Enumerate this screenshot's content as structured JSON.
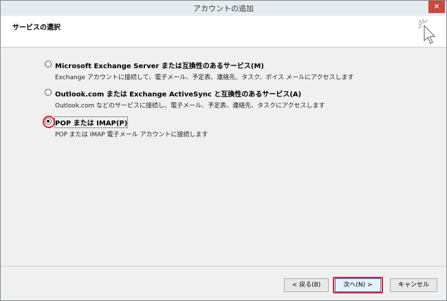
{
  "window": {
    "title": "アカウントの追加",
    "close_symbol": "✕"
  },
  "header": {
    "title": "サービスの選択",
    "icon": "cursor-sparkle-icon"
  },
  "options": [
    {
      "label": "Microsoft Exchange Server または互換性のあるサービス(M)",
      "description": "Exchange アカウントに接続して、電子メール、予定表、連絡先、タスク、ボイス メールにアクセスします",
      "selected": false
    },
    {
      "label": "Outlook.com または Exchange ActiveSync と互換性のあるサービス(A)",
      "description": "Outlook.com などのサービスに接続し、電子メール、予定表、連絡先、タスクにアクセスします",
      "selected": false
    },
    {
      "label": "POP または IMAP(P)",
      "description": "POP または IMAP 電子メール アカウントに接続します",
      "selected": true
    }
  ],
  "buttons": {
    "back": "< 戻る(B)",
    "next": "次へ(N) >",
    "cancel": "キャンセル"
  },
  "colors": {
    "highlight": "#d71f35",
    "close": "#c7493f"
  }
}
